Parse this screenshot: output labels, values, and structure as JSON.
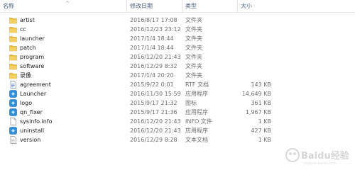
{
  "columns": {
    "name": "名称",
    "date": "修改日期",
    "type": "类型",
    "size": "大小"
  },
  "files": [
    {
      "name": "artist",
      "date": "2016/8/17 17:08",
      "type": "文件夹",
      "size": "",
      "icon": "folder-icon"
    },
    {
      "name": "cc",
      "date": "2016/12/23 23:12",
      "type": "文件夹",
      "size": "",
      "icon": "folder-icon"
    },
    {
      "name": "launcher",
      "date": "2017/1/4 18:44",
      "type": "文件夹",
      "size": "",
      "icon": "folder-icon"
    },
    {
      "name": "patch",
      "date": "2017/1/4 18:44",
      "type": "文件夹",
      "size": "",
      "icon": "folder-icon"
    },
    {
      "name": "program",
      "date": "2016/12/20 21:43",
      "type": "文件夹",
      "size": "",
      "icon": "folder-icon"
    },
    {
      "name": "software",
      "date": "2016/12/29 8:32",
      "type": "文件夹",
      "size": "",
      "icon": "folder-icon"
    },
    {
      "name": "录像",
      "date": "2017/1/4 20:20",
      "type": "文件夹",
      "size": "",
      "icon": "folder-icon"
    },
    {
      "name": "agreement",
      "date": "2015/9/22 0:01",
      "type": "RTF 文档",
      "size": "143 KB",
      "icon": "rtf-document-icon"
    },
    {
      "name": "Launcher",
      "date": "2016/11/30 15:59",
      "type": "应用程序",
      "size": "14,649 KB",
      "icon": "application-icon"
    },
    {
      "name": "logo",
      "date": "2015/9/17 21:32",
      "type": "图标",
      "size": "361 KB",
      "icon": "application-icon"
    },
    {
      "name": "qn_fixer",
      "date": "2015/9/17 21:36",
      "type": "应用程序",
      "size": "1,967 KB",
      "icon": "application-icon"
    },
    {
      "name": "sysinfo.info",
      "date": "2016/12/20 21:43",
      "type": "INFO 文件",
      "size": "1 KB",
      "icon": "generic-file-icon"
    },
    {
      "name": "uninstall",
      "date": "2016/12/20 21:43",
      "type": "应用程序",
      "size": "427 KB",
      "icon": "application-icon"
    },
    {
      "name": "version",
      "date": "2016/12/29 8:28",
      "type": "文本文档",
      "size": "1 KB",
      "icon": "text-document-icon"
    }
  ],
  "watermark": {
    "text": "Baidu经验",
    "sub": "jingyan.baidu.com"
  }
}
